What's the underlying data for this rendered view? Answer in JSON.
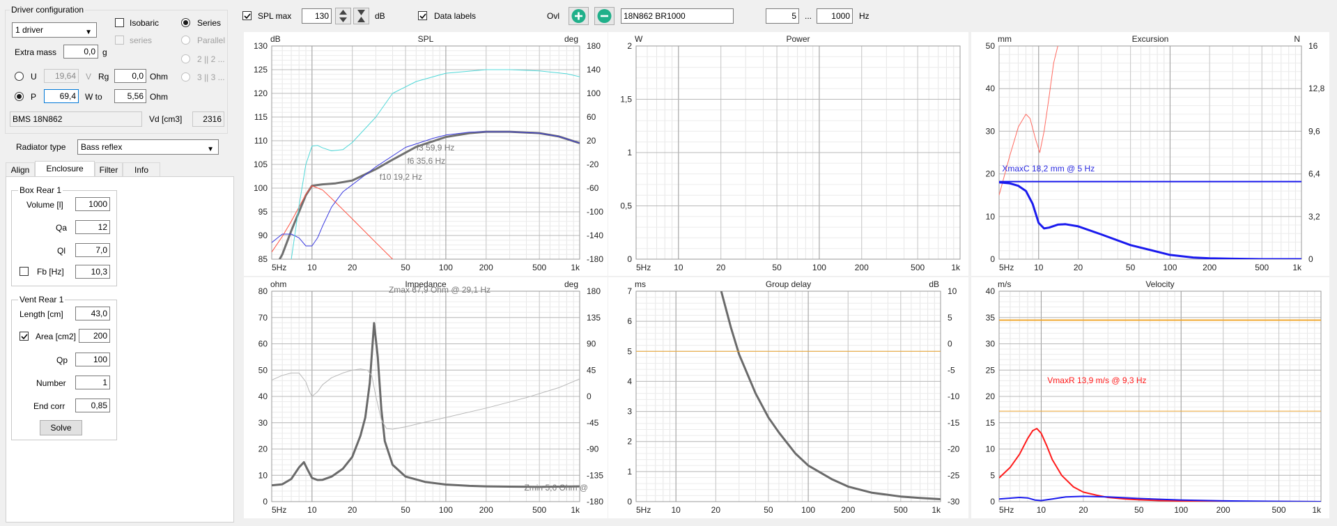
{
  "driver_config": {
    "title": "Driver configuration",
    "drivers_select": "1 driver",
    "isobaric_label": "Isobaric",
    "series_radio_label": "Series",
    "series_label": "series",
    "parallel_label": "Parallel",
    "opt_2p2": "2 || 2 ...",
    "opt_3p3": "3 || 3 ...",
    "extra_mass_label": "Extra mass",
    "extra_mass_value": "0,0",
    "extra_mass_unit": "g",
    "u_label": "U",
    "u_value": "19,64",
    "u_unit": "V",
    "rg_label": "Rg",
    "rg_value": "0,0",
    "rg_unit": "Ohm",
    "p_label": "P",
    "p_value": "69,4",
    "wto_label": "W to",
    "wto_value": "5,56",
    "wto_unit": "Ohm",
    "driver_name": "BMS 18N862",
    "vd_label": "Vd [cm3]",
    "vd_value": "2316"
  },
  "radiator": {
    "label": "Radiator type",
    "value": "Bass reflex"
  },
  "tabs": [
    "Align",
    "Enclosure",
    "Filter",
    "Info"
  ],
  "box": {
    "title": "Box Rear 1",
    "volume_label": "Volume [l]",
    "volume": "1000",
    "qa_label": "Qa",
    "qa": "12",
    "ql_label": "Ql",
    "ql": "7,0",
    "fb_label": "Fb [Hz]",
    "fb": "10,3"
  },
  "vent": {
    "title": "Vent Rear 1",
    "length_label": "Length [cm]",
    "length": "43,0",
    "area_label": "Area [cm2]",
    "area": "200",
    "qp_label": "Qp",
    "qp": "100",
    "number_label": "Number",
    "number": "1",
    "endcorr_label": "End corr",
    "endcorr": "0,85",
    "solve_label": "Solve"
  },
  "toolbar": {
    "splmax_label": "SPL max",
    "splmax_value": "130",
    "db_unit": "dB",
    "datalabels_label": "Data labels",
    "ovl_label": "Ovl",
    "overlay_name": "18N862 BR1000",
    "fmin": "5",
    "range_sep": "...",
    "fmax": "1000",
    "hz_unit": "Hz"
  },
  "chart_data": [
    {
      "type": "line",
      "title": "SPL",
      "ylabel": "dB",
      "y2label": "deg",
      "xticks": [
        "5Hz",
        "10",
        "20",
        "50",
        "100",
        "200",
        "500",
        "1k"
      ],
      "yticks": [
        "130",
        "125",
        "120",
        "115",
        "110",
        "105",
        "100",
        "95",
        "90",
        "85"
      ],
      "y2ticks": [
        "180",
        "140",
        "100",
        "60",
        "20",
        "-20",
        "-60",
        "-100",
        "-140",
        "-180"
      ],
      "ylim": [
        85,
        130
      ],
      "y2lim": [
        -180,
        180
      ],
      "xlim": [
        5,
        1000
      ],
      "xscale": "log",
      "annotations": [
        "f3 59,9 Hz",
        "f6 35,6 Hz",
        "f10 19,2 Hz"
      ],
      "series": [
        {
          "color": "#707070",
          "width": 3,
          "axis": "y",
          "x": [
            5,
            6,
            7,
            8,
            9,
            10,
            12,
            15,
            20,
            30,
            40,
            60,
            100,
            150,
            200,
            300,
            500,
            700,
            1000
          ],
          "values": [
            82,
            86,
            91,
            95,
            98.5,
            100.5,
            100.8,
            101,
            101.6,
            104,
            106,
            108.7,
            110.8,
            111.6,
            111.9,
            111.9,
            111.6,
            110.9,
            109.5
          ]
        },
        {
          "color": "#ff5040",
          "width": 1,
          "axis": "y",
          "x": [
            5,
            6,
            7,
            8,
            9,
            10,
            12,
            15,
            20,
            30,
            40
          ],
          "values": [
            86.5,
            89.8,
            93,
            96,
            98.7,
            100.5,
            99.6,
            97,
            93.5,
            88.5,
            85
          ]
        },
        {
          "color": "#3a3ae0",
          "width": 1,
          "axis": "y",
          "x": [
            5,
            6,
            7,
            8,
            9,
            10,
            11,
            12,
            14,
            17,
            20,
            30,
            50,
            80,
            100,
            150,
            200,
            300,
            500,
            700,
            1000
          ],
          "values": [
            88.5,
            90.3,
            90.3,
            89.5,
            87.8,
            87.8,
            89.5,
            92,
            96,
            99.2,
            100.7,
            104.5,
            108.6,
            110.5,
            111.2,
            111.8,
            111.9,
            111.9,
            111.6,
            110.9,
            109.5
          ]
        },
        {
          "color": "#50d8d8",
          "width": 1,
          "axis": "y2",
          "x": [
            7,
            8,
            9,
            10,
            11,
            12,
            14,
            17,
            20,
            30,
            40,
            60,
            100,
            200,
            300,
            500,
            800,
            1000
          ],
          "values": [
            -180,
            -90,
            -20,
            11,
            12,
            8,
            3,
            5,
            17,
            60,
            100,
            120,
            134,
            140,
            140,
            138,
            133,
            128
          ]
        }
      ]
    },
    {
      "type": "line",
      "title": "Power",
      "ylabel": "W",
      "xticks": [
        "5Hz",
        "10",
        "20",
        "50",
        "100",
        "200",
        "500",
        "1k"
      ],
      "yticks": [
        "2",
        "1,5",
        "1",
        "0,5",
        "0"
      ],
      "ylim": [
        0,
        2
      ],
      "xlim": [
        5,
        1000
      ],
      "xscale": "log",
      "series": []
    },
    {
      "type": "line",
      "title": "Excursion",
      "ylabel": "mm",
      "y2label": "N",
      "xticks": [
        "5Hz",
        "10",
        "20",
        "50",
        "100",
        "200",
        "500",
        "1k"
      ],
      "yticks": [
        "50",
        "40",
        "30",
        "20",
        "10",
        "0"
      ],
      "y2ticks": [
        "16",
        "12,8",
        "9,6",
        "6,4",
        "3,2",
        "0"
      ],
      "ylim": [
        0,
        50
      ],
      "y2lim": [
        0,
        16
      ],
      "xlim": [
        5,
        1000
      ],
      "xscale": "log",
      "annotations": [
        "XmaxC 18,2 mm  @ 5 Hz"
      ],
      "series": [
        {
          "color": "#ff6a60",
          "width": 1,
          "axis": "y",
          "x": [
            5,
            6,
            7,
            8,
            8.6,
            9.5,
            10.2,
            11,
            12,
            13,
            14
          ],
          "values": [
            15,
            24,
            31,
            34,
            33,
            28,
            25,
            30,
            38,
            46,
            50
          ]
        },
        {
          "color": "#1a1aee",
          "width": 3,
          "axis": "y",
          "x": [
            5,
            6,
            7,
            8,
            9,
            10,
            11,
            12,
            14,
            16,
            20,
            30,
            50,
            100,
            150,
            200,
            300,
            500,
            1000
          ],
          "values": [
            18,
            17.8,
            17.2,
            16,
            13,
            8.5,
            7.2,
            7.4,
            8.1,
            8.2,
            7.7,
            5.8,
            3.3,
            1,
            0.4,
            0.2,
            0.1,
            0,
            0
          ]
        },
        {
          "color": "#1a1aee",
          "width": 2,
          "axis": "y",
          "x": [
            5,
            1000
          ],
          "values": [
            18.2,
            18.2
          ]
        }
      ]
    },
    {
      "type": "line",
      "title": "Impedance",
      "ylabel": "ohm",
      "y2label": "deg",
      "xticks": [
        "5Hz",
        "10",
        "20",
        "50",
        "100",
        "200",
        "500",
        "1k"
      ],
      "yticks": [
        "80",
        "70",
        "60",
        "50",
        "40",
        "30",
        "20",
        "10",
        "0"
      ],
      "y2ticks": [
        "180",
        "135",
        "90",
        "45",
        "0",
        "-45",
        "-90",
        "-135",
        "-180"
      ],
      "ylim": [
        0,
        80
      ],
      "y2lim": [
        -180,
        180
      ],
      "xlim": [
        5,
        1000
      ],
      "xscale": "log",
      "annotations": [
        "Zmax 67,9 Ohm @ 29,1 Hz",
        "Zmin 5,6 Ohm @"
      ],
      "series": [
        {
          "color": "#6a6a6a",
          "width": 3,
          "axis": "y",
          "x": [
            5,
            6,
            7,
            8,
            8.7,
            9.3,
            10,
            11,
            12,
            14,
            17,
            20,
            23,
            25,
            27,
            29.1,
            31,
            33,
            35,
            40,
            50,
            70,
            100,
            150,
            200,
            300,
            500,
            1000
          ],
          "values": [
            6.2,
            6.6,
            8.6,
            13,
            15,
            12,
            9,
            8.2,
            8.3,
            9.5,
            12.5,
            17,
            25,
            32,
            45,
            67.9,
            55,
            35,
            23,
            14,
            9.5,
            7.5,
            6.5,
            6,
            5.8,
            5.7,
            5.6,
            5.8
          ]
        },
        {
          "color": "#b8b8b8",
          "width": 1,
          "axis": "y2",
          "x": [
            5,
            6,
            7,
            8,
            9,
            9.5,
            10,
            11,
            12,
            14,
            17,
            20,
            23,
            26,
            28,
            30,
            33,
            36,
            40,
            50,
            70,
            100,
            200,
            400,
            700,
            1000
          ],
          "values": [
            28,
            36,
            40,
            40,
            25,
            10,
            0,
            8,
            20,
            32,
            40,
            45,
            47,
            45,
            35,
            0,
            -40,
            -55,
            -56,
            -52,
            -44,
            -36,
            -20,
            -2,
            15,
            30
          ]
        }
      ]
    },
    {
      "type": "line",
      "title": "Group delay",
      "ylabel": "ms",
      "y2label": "dB",
      "xticks": [
        "5Hz",
        "10",
        "20",
        "50",
        "100",
        "200",
        "500",
        "1k"
      ],
      "yticks": [
        "7",
        "6",
        "5",
        "4",
        "3",
        "2",
        "1",
        "0"
      ],
      "y2ticks": [
        "10",
        "5",
        "0",
        "-5",
        "-10",
        "-15",
        "-20",
        "-25",
        "-30"
      ],
      "ylim": [
        0,
        7
      ],
      "y2lim": [
        -30,
        10
      ],
      "xlim": [
        5,
        1000
      ],
      "xscale": "log",
      "series": [
        {
          "color": "#6a6a6a",
          "width": 3,
          "axis": "y",
          "x": [
            22,
            26,
            30,
            40,
            50,
            60,
            80,
            100,
            150,
            200,
            300,
            500,
            700,
            1000
          ],
          "values": [
            7,
            5.8,
            4.9,
            3.6,
            2.8,
            2.3,
            1.6,
            1.2,
            0.75,
            0.5,
            0.3,
            0.17,
            0.12,
            0.08
          ]
        },
        {
          "color": "#f0a830",
          "width": 1,
          "axis": "y",
          "x": [
            5,
            1000
          ],
          "values": [
            5,
            5
          ]
        }
      ]
    },
    {
      "type": "line",
      "title": "Velocity",
      "ylabel": "m/s",
      "xticks": [
        "5Hz",
        "10",
        "20",
        "50",
        "100",
        "200",
        "500",
        "1k"
      ],
      "yticks": [
        "40",
        "35",
        "30",
        "25",
        "20",
        "15",
        "10",
        "5",
        "0"
      ],
      "ylim": [
        0,
        40
      ],
      "xlim": [
        5,
        1000
      ],
      "xscale": "log",
      "annotations": [
        "VmaxR 13,9 m/s @ 9,3 Hz"
      ],
      "series": [
        {
          "color": "#ff1a1a",
          "width": 2,
          "axis": "y",
          "x": [
            5,
            6,
            7,
            8,
            8.7,
            9.3,
            10,
            11,
            12,
            14,
            17,
            20,
            25,
            30,
            40,
            50,
            70,
            100,
            150,
            200,
            300,
            500,
            1000
          ],
          "values": [
            4.5,
            6.5,
            9,
            12,
            13.5,
            13.9,
            13,
            10.5,
            8,
            5,
            2.8,
            1.8,
            1.2,
            0.8,
            0.5,
            0.35,
            0.2,
            0.12,
            0.06,
            0.04,
            0.02,
            0.01,
            0
          ]
        },
        {
          "color": "#1a1aee",
          "width": 2,
          "axis": "y",
          "x": [
            5,
            7,
            8,
            9,
            10,
            12,
            15,
            20,
            30,
            50,
            100,
            200,
            500,
            1000
          ],
          "values": [
            0.5,
            0.8,
            0.7,
            0.3,
            0.2,
            0.5,
            0.9,
            1,
            0.9,
            0.6,
            0.3,
            0.15,
            0.05,
            0
          ]
        },
        {
          "color": "#f0a830",
          "width": 2,
          "axis": "y",
          "x": [
            5,
            1000
          ],
          "values": [
            34.5,
            34.5
          ]
        },
        {
          "color": "#f0a830",
          "width": 1,
          "axis": "y",
          "x": [
            5,
            1000
          ],
          "values": [
            17.2,
            17.2
          ]
        }
      ]
    }
  ]
}
